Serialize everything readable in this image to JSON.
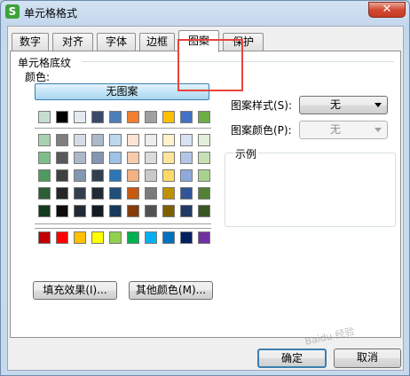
{
  "window": {
    "icon_letter": "S",
    "title": "单元格格式",
    "close_glyph": "✕"
  },
  "tabs": [
    {
      "label": "数字",
      "active": false
    },
    {
      "label": "对齐",
      "active": false
    },
    {
      "label": "字体",
      "active": false
    },
    {
      "label": "边框",
      "active": false
    },
    {
      "label": "图案",
      "active": true
    },
    {
      "label": "保护",
      "active": false
    }
  ],
  "shading": {
    "group_label": "单元格底纹",
    "color_label": "颜色:",
    "no_pattern_button": "无图案",
    "fill_effects_button": "填充效果(I)...",
    "more_colors_button": "其他颜色(M)..."
  },
  "palette": {
    "row1": [
      "#c5dfce",
      "#000000",
      "#e4eaf0",
      "#3a4a66",
      "#4e7fb9",
      "#f07f31",
      "#a0a0a0",
      "#fcc000",
      "#4472c4",
      "#6fad46"
    ],
    "tint_rows": [
      [
        "#a8d1b0",
        "#7f7f7f",
        "#d6dce5",
        "#acb9ca",
        "#bdd7ee",
        "#fbe4d5",
        "#ededed",
        "#fff2cc",
        "#d9e2f3",
        "#e2efd9"
      ],
      [
        "#7fbe8a",
        "#595959",
        "#adb9ca",
        "#8497b0",
        "#9dc3e6",
        "#f8cbad",
        "#dbdbdb",
        "#ffe599",
        "#b4c6e7",
        "#c5e0b3"
      ],
      [
        "#4f9a5f",
        "#3f3f3f",
        "#8497b0",
        "#323f4f",
        "#2e75b6",
        "#f4b183",
        "#c9c9c9",
        "#ffd966",
        "#8eaadb",
        "#a9d18e"
      ],
      [
        "#2a5e36",
        "#262626",
        "#333f4f",
        "#222a35",
        "#1f4e79",
        "#c55a11",
        "#7b7b7b",
        "#bf9000",
        "#2f5597",
        "#538135"
      ],
      [
        "#133a1c",
        "#0c0c0c",
        "#222a35",
        "#161b23",
        "#163a5a",
        "#843c0c",
        "#525252",
        "#7f6000",
        "#1f3864",
        "#385723"
      ]
    ],
    "standard_row": [
      "#c00000",
      "#ff0000",
      "#ffc000",
      "#ffff00",
      "#92d050",
      "#00b050",
      "#00b0f0",
      "#0070c0",
      "#002060",
      "#7030a0"
    ]
  },
  "pattern": {
    "style_label": "图案样式(S):",
    "style_value": "无",
    "color_label": "图案颜色(P):",
    "color_value": "无",
    "example_label": "示例"
  },
  "footer": {
    "ok_button": "确定",
    "cancel_button": "取消"
  },
  "watermark": "Baidu 经验"
}
